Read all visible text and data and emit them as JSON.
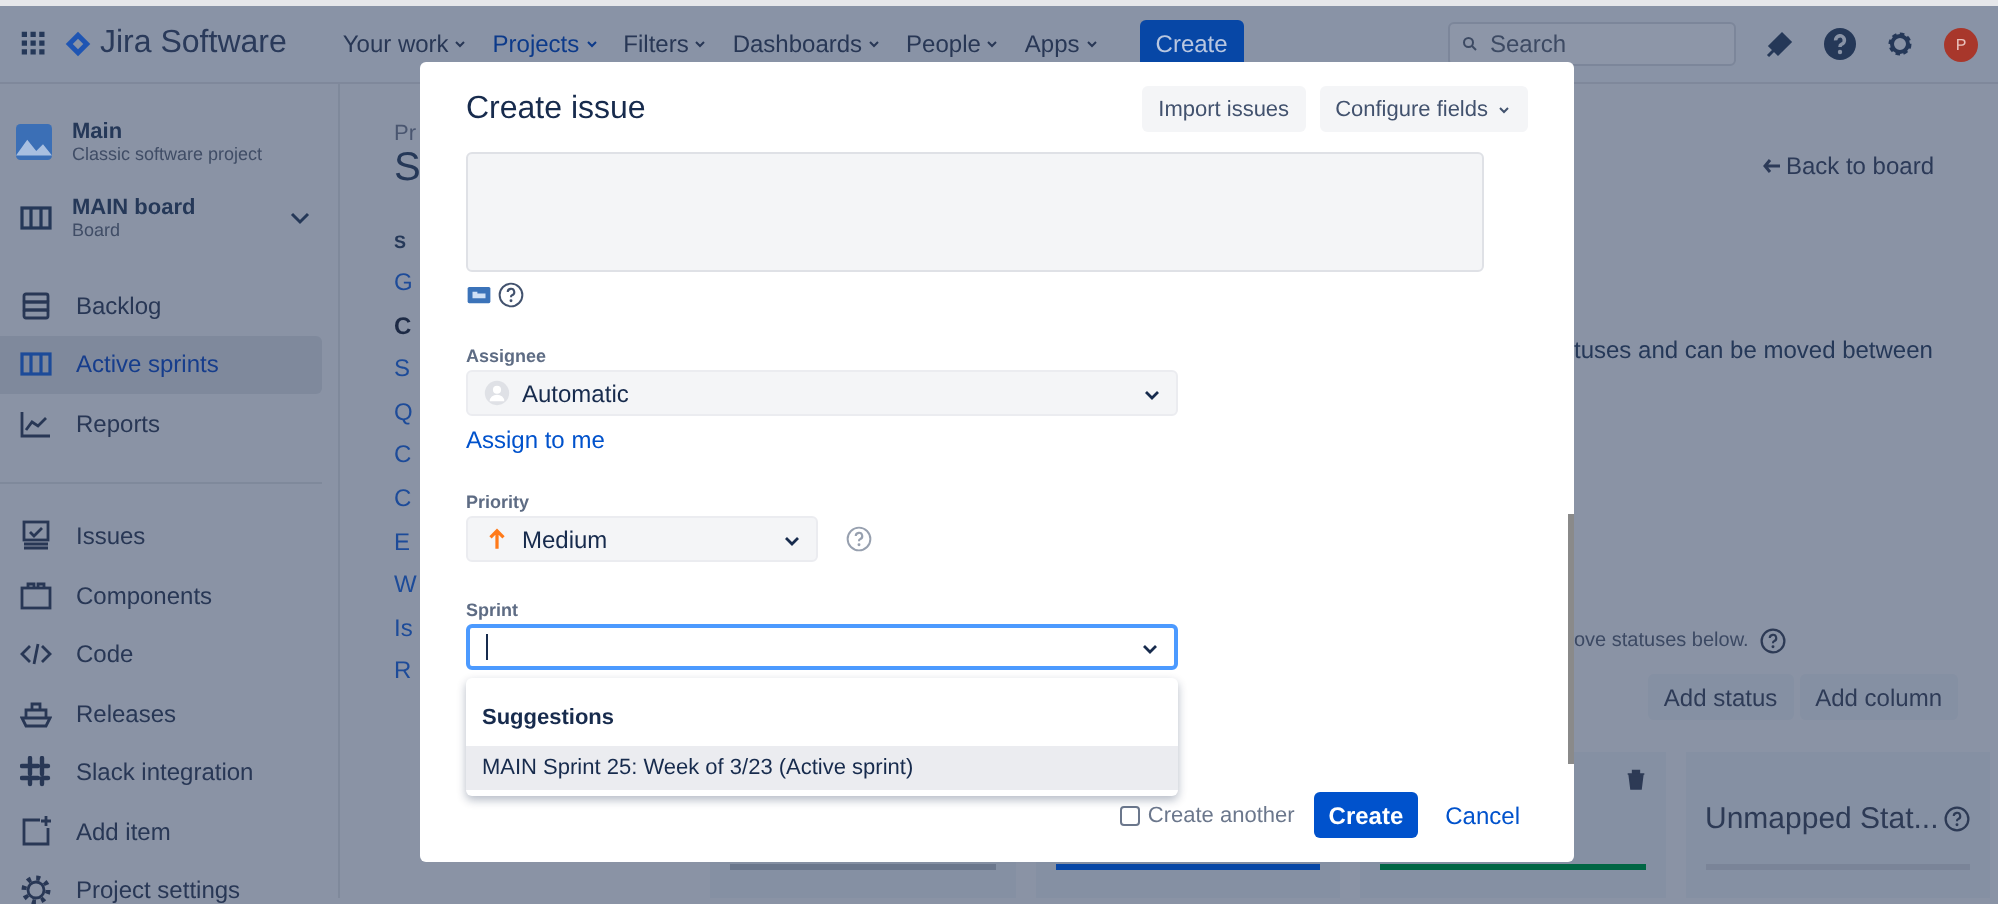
{
  "top_nav": {
    "app_name": "Jira Software",
    "menus": [
      {
        "label": "Your work",
        "selected": false
      },
      {
        "label": "Projects",
        "selected": true
      },
      {
        "label": "Filters",
        "selected": false
      },
      {
        "label": "Dashboards",
        "selected": false
      },
      {
        "label": "People",
        "selected": false
      },
      {
        "label": "Apps",
        "selected": false
      }
    ],
    "create_button": "Create",
    "search": {
      "placeholder": "Search"
    },
    "avatar_initial": "P"
  },
  "sidebar": {
    "project": {
      "name": "Main",
      "type": "Classic software project"
    },
    "board": {
      "name": "MAIN board",
      "subtitle": "Board"
    },
    "item_groups": [
      {
        "items": [
          {
            "label": "Backlog",
            "selected": false
          },
          {
            "label": "Active sprints",
            "selected": true
          },
          {
            "label": "Reports",
            "selected": false
          }
        ]
      },
      {
        "items": [
          {
            "label": "Issues",
            "selected": false
          },
          {
            "label": "Components",
            "selected": false
          },
          {
            "label": "Code",
            "selected": false
          },
          {
            "label": "Releases",
            "selected": false
          },
          {
            "label": "Slack integration",
            "selected": false
          },
          {
            "label": "Add item",
            "selected": false
          },
          {
            "label": "Project settings",
            "selected": false
          }
        ]
      }
    ]
  },
  "page": {
    "breadcrumb": "Pr",
    "title": "S",
    "section_heading": "S",
    "settings_nav": [
      {
        "label": "G",
        "selected": false
      },
      {
        "label": "C",
        "selected": true
      },
      {
        "label": "S",
        "selected": false
      },
      {
        "label": "Q",
        "selected": false
      },
      {
        "label": "C",
        "selected": false
      },
      {
        "label": "C",
        "selected": false
      },
      {
        "label": "E",
        "selected": false
      },
      {
        "label": "W",
        "selected": false
      },
      {
        "label": "Is",
        "selected": false
      },
      {
        "label": "R",
        "selected": false
      }
    ],
    "back_link": "Back to board",
    "description": "tuses and can be moved between",
    "hint": "ove statuses below.",
    "buttons": [
      "Add status",
      "Add column"
    ],
    "columns": [
      {
        "kind": "column",
        "color": "#6b778c"
      },
      {
        "kind": "column",
        "color": "#0747a6"
      },
      {
        "kind": "column-with-delete",
        "color": "#006644"
      },
      {
        "kind": "unmapped",
        "title": "Unmapped Stat...",
        "color": "#7a8498"
      }
    ]
  },
  "modal": {
    "title": "Create issue",
    "header_buttons": [
      {
        "label": "Import issues",
        "dropdown": false
      },
      {
        "label": "Configure fields",
        "dropdown": true
      }
    ],
    "fields": [
      {
        "kind": "textarea"
      },
      {
        "kind": "user-select",
        "label": "Assignee",
        "value": "Automatic",
        "link": "Assign to me"
      },
      {
        "kind": "priority-select",
        "label": "Priority",
        "value": "Medium",
        "help": true
      },
      {
        "kind": "input",
        "label": "Sprint",
        "focused": true
      }
    ],
    "suggestions": {
      "heading": "Suggestions",
      "items": [
        {
          "label": "MAIN Sprint 25: Week of 3/23 (Active sprint)",
          "selected": true
        }
      ]
    },
    "create_another": {
      "label": "Create another",
      "checked": false
    },
    "submit": "Create",
    "cancel": "Cancel"
  }
}
